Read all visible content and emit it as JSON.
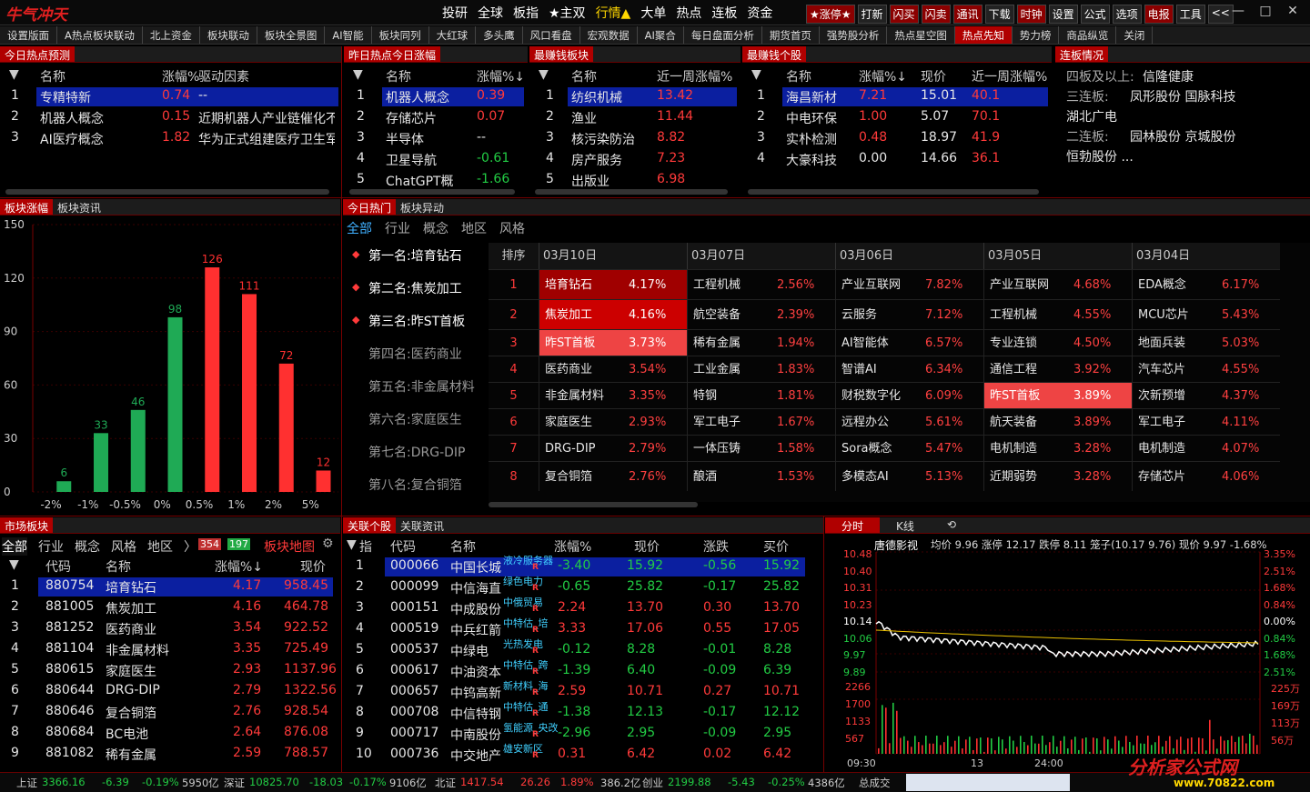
{
  "app": {
    "logo": "牛气冲天"
  },
  "menu": [
    "投研",
    "全球",
    "板指",
    "★主双",
    "行情▲",
    "大单",
    "热点",
    "连板",
    "资金"
  ],
  "right_buttons": [
    "★涨停★",
    "打新",
    "闪买",
    "闪卖",
    "通讯",
    "下载",
    "时钟",
    "设置",
    "公式",
    "选项",
    "电报",
    "工具",
    "<<"
  ],
  "window_controls": [
    "—",
    "□",
    "✕"
  ],
  "tabs": [
    "设置版面",
    "A热点板块联动",
    "北上资金",
    "板块联动",
    "板块全景图",
    "AI智能",
    "板块同列",
    "大红球",
    "多头鹰",
    "风口看盘",
    "宏观数据",
    "AI聚合",
    "每日盘面分析",
    "期货首页",
    "强势股分析",
    "热点星空图",
    "热点先知",
    "势力榜",
    "商品纵览",
    "关闭"
  ],
  "p1": {
    "title": "今日热点预测",
    "headers": [
      "名称",
      "涨幅%",
      "驱动因素"
    ],
    "rows": [
      {
        "n": "1",
        "name": "专精特新",
        "pct": "0.74",
        "drv": "--"
      },
      {
        "n": "2",
        "name": "机器人概念",
        "pct": "0.15",
        "drv": "近期机器人产业链催化不"
      },
      {
        "n": "3",
        "name": "AI医疗概念",
        "pct": "1.82",
        "drv": "华为正式组建医疗卫生军"
      }
    ]
  },
  "p2": {
    "title": "昨日热点今日涨幅",
    "headers": [
      "名称",
      "涨幅%↓"
    ],
    "rows": [
      {
        "n": "1",
        "name": "机器人概念",
        "pct": "0.39"
      },
      {
        "n": "2",
        "name": "存储芯片",
        "pct": "0.07"
      },
      {
        "n": "3",
        "name": "半导体",
        "pct": "--"
      },
      {
        "n": "4",
        "name": "卫星导航",
        "pct": "-0.61"
      },
      {
        "n": "5",
        "name": "ChatGPT概",
        "pct": "-1.66"
      }
    ]
  },
  "p3": {
    "title": "最赚钱板块",
    "headers": [
      "名称",
      "近一周涨幅%"
    ],
    "rows": [
      {
        "n": "1",
        "name": "纺织机械",
        "pct": "13.42"
      },
      {
        "n": "2",
        "name": "渔业",
        "pct": "11.44"
      },
      {
        "n": "3",
        "name": "核污染防治",
        "pct": "8.82"
      },
      {
        "n": "4",
        "name": "房产服务",
        "pct": "7.23"
      },
      {
        "n": "5",
        "name": "出版业",
        "pct": "6.98"
      }
    ]
  },
  "p4": {
    "title": "最赚钱个股",
    "headers": [
      "名称",
      "涨幅%↓",
      "现价",
      "近一周涨幅%"
    ],
    "rows": [
      {
        "n": "1",
        "name": "海昌新材",
        "pct": "7.21",
        "price": "15.01",
        "week": "40.1"
      },
      {
        "n": "2",
        "name": "中电环保",
        "pct": "1.00",
        "price": "5.07",
        "week": "70.1"
      },
      {
        "n": "3",
        "name": "实朴检测",
        "pct": "0.48",
        "price": "18.97",
        "week": "41.9"
      },
      {
        "n": "4",
        "name": "大豪科技",
        "pct": "0.00",
        "price": "14.66",
        "week": "36.1"
      }
    ]
  },
  "p5": {
    "title": "连板情况",
    "lines": [
      {
        "label": "四板及以上:",
        "stocks": "信隆健康"
      },
      {
        "label": "三连板:",
        "stocks": "凤形股份  国脉科技"
      },
      {
        "label": "",
        "stocks": "湖北广电"
      },
      {
        "label": "二连板:",
        "stocks": "园林股份  京城股份"
      },
      {
        "label": "",
        "stocks": "恒勃股份     ..."
      }
    ]
  },
  "chart_panel": {
    "tabs": [
      "板块涨幅",
      "板块资讯"
    ]
  },
  "chart_data": {
    "type": "bar",
    "categories": [
      "-2%",
      "-1%",
      "-0.5%",
      "0%",
      "0.5%",
      "1%",
      "2%",
      "5%"
    ],
    "values": [
      6,
      33,
      46,
      98,
      126,
      111,
      72,
      12
    ],
    "colors": [
      "#1faa55",
      "#1faa55",
      "#1faa55",
      "#1faa55",
      "#ff3030",
      "#ff3030",
      "#ff3030",
      "#ff3030"
    ],
    "ylim": [
      0,
      150
    ],
    "yticks": [
      0,
      30,
      60,
      90,
      120,
      150
    ],
    "grid": true
  },
  "hot": {
    "tabs": [
      "今日热门",
      "板块异动"
    ],
    "filters": [
      "全部",
      "行业",
      "概念",
      "地区",
      "风格"
    ],
    "ranks": [
      "第一名:培育钻石",
      "第二名:焦炭加工",
      "第三名:昨ST首板",
      "第四名:医药商业",
      "第五名:非金属材料",
      "第六名:家庭医生",
      "第七名:DRG-DIP",
      "第八名:复合铜箔"
    ],
    "rank_header": "排序",
    "dates": [
      "03月10日",
      "03月07日",
      "03月06日",
      "03月05日",
      "03月04日"
    ],
    "grid": [
      [
        [
          "培育钻石",
          "4.17%"
        ],
        [
          "工程机械",
          "2.56%"
        ],
        [
          "产业互联网",
          "7.82%"
        ],
        [
          "产业互联网",
          "4.68%"
        ],
        [
          "EDA概念",
          "6.17%"
        ]
      ],
      [
        [
          "焦炭加工",
          "4.16%"
        ],
        [
          "航空装备",
          "2.39%"
        ],
        [
          "云服务",
          "7.12%"
        ],
        [
          "工程机械",
          "4.55%"
        ],
        [
          "MCU芯片",
          "5.43%"
        ]
      ],
      [
        [
          "昨ST首板",
          "3.73%"
        ],
        [
          "稀有金属",
          "1.94%"
        ],
        [
          "AI智能体",
          "6.57%"
        ],
        [
          "专业连锁",
          "4.50%"
        ],
        [
          "地面兵装",
          "5.03%"
        ]
      ],
      [
        [
          "医药商业",
          "3.54%"
        ],
        [
          "工业金属",
          "1.83%"
        ],
        [
          "智谱AI",
          "6.34%"
        ],
        [
          "通信工程",
          "3.92%"
        ],
        [
          "汽车芯片",
          "4.55%"
        ]
      ],
      [
        [
          "非金属材料",
          "3.35%"
        ],
        [
          "特钢",
          "1.81%"
        ],
        [
          "财税数字化",
          "6.09%"
        ],
        [
          "昨ST首板",
          "3.89%"
        ],
        [
          "次新预增",
          "4.37%"
        ]
      ],
      [
        [
          "家庭医生",
          "2.93%"
        ],
        [
          "军工电子",
          "1.67%"
        ],
        [
          "远程办公",
          "5.61%"
        ],
        [
          "航天装备",
          "3.89%"
        ],
        [
          "军工电子",
          "4.11%"
        ]
      ],
      [
        [
          "DRG-DIP",
          "2.79%"
        ],
        [
          "一体压铸",
          "1.58%"
        ],
        [
          "Sora概念",
          "5.47%"
        ],
        [
          "电机制造",
          "3.28%"
        ],
        [
          "电机制造",
          "4.07%"
        ]
      ],
      [
        [
          "复合铜箔",
          "2.76%"
        ],
        [
          "酿酒",
          "1.53%"
        ],
        [
          "多模态AI",
          "5.13%"
        ],
        [
          "近期弱势",
          "3.28%"
        ],
        [
          "存储芯片",
          "4.06%"
        ]
      ]
    ]
  },
  "market": {
    "tabs": [
      "市场板块"
    ],
    "filters": [
      "全部",
      "行业",
      "概念",
      "风格",
      "地区",
      "〉"
    ],
    "up_count": "354",
    "down_count": "197",
    "map_link": "板块地图",
    "headers": [
      "代码",
      "名称",
      "涨幅%↓",
      "现价"
    ],
    "rows": [
      {
        "n": "1",
        "code": "880754",
        "name": "培育钻石",
        "pct": "4.17",
        "price": "958.45"
      },
      {
        "n": "2",
        "code": "881005",
        "name": "焦炭加工",
        "pct": "4.16",
        "price": "464.78"
      },
      {
        "n": "3",
        "code": "881252",
        "name": "医药商业",
        "pct": "3.54",
        "price": "922.52"
      },
      {
        "n": "4",
        "code": "881104",
        "name": "非金属材料",
        "pct": "3.35",
        "price": "725.49"
      },
      {
        "n": "5",
        "code": "880615",
        "name": "家庭医生",
        "pct": "2.93",
        "price": "1137.96"
      },
      {
        "n": "6",
        "code": "880644",
        "name": "DRG-DIP",
        "pct": "2.79",
        "price": "1322.56"
      },
      {
        "n": "7",
        "code": "880646",
        "name": "复合铜箔",
        "pct": "2.76",
        "price": "928.54"
      },
      {
        "n": "8",
        "code": "880684",
        "name": "BC电池",
        "pct": "2.64",
        "price": "876.08"
      },
      {
        "n": "9",
        "code": "881082",
        "name": "稀有金属",
        "pct": "2.59",
        "price": "788.57"
      }
    ]
  },
  "stocks": {
    "tabs": [
      "关联个股",
      "关联资讯"
    ],
    "headers": [
      "指",
      "代码",
      "名称",
      "涨幅%",
      "现价",
      "涨跌",
      "买价"
    ],
    "rows": [
      {
        "n": "1",
        "code": "000066",
        "name": "中国长城",
        "tag": "液冷服务器",
        "pct": "-3.40",
        "price": "15.92",
        "chg": "-0.56",
        "bid": "15.92"
      },
      {
        "n": "2",
        "code": "000099",
        "name": "中信海直",
        "tag": "绿色电力",
        "pct": "-0.65",
        "price": "25.82",
        "chg": "-0.17",
        "bid": "25.82"
      },
      {
        "n": "3",
        "code": "000151",
        "name": "中成股份",
        "tag": "中俄贸易",
        "pct": "2.24",
        "price": "13.70",
        "chg": "0.30",
        "bid": "13.70"
      },
      {
        "n": "4",
        "code": "000519",
        "name": "中兵红箭",
        "tag": "中特估_培",
        "pct": "3.33",
        "price": "17.06",
        "chg": "0.55",
        "bid": "17.05"
      },
      {
        "n": "5",
        "code": "000537",
        "name": "中绿电",
        "tag": "光热发电",
        "pct": "-0.12",
        "price": "8.28",
        "chg": "-0.01",
        "bid": "8.28"
      },
      {
        "n": "6",
        "code": "000617",
        "name": "中油资本",
        "tag": "中特估_跨",
        "pct": "-1.39",
        "price": "6.40",
        "chg": "-0.09",
        "bid": "6.39"
      },
      {
        "n": "7",
        "code": "000657",
        "name": "中钨高新",
        "tag": "新材料_海",
        "pct": "2.59",
        "price": "10.71",
        "chg": "0.27",
        "bid": "10.71"
      },
      {
        "n": "8",
        "code": "000708",
        "name": "中信特钢",
        "tag": "中特估_通",
        "pct": "-1.38",
        "price": "12.13",
        "chg": "-0.17",
        "bid": "12.12"
      },
      {
        "n": "9",
        "code": "000717",
        "name": "中南股份",
        "tag": "氢能源_央改",
        "pct": "-2.96",
        "price": "2.95",
        "chg": "-0.09",
        "bid": "2.95"
      },
      {
        "n": "10",
        "code": "000736",
        "name": "中交地产",
        "tag": "雄安新区",
        "pct": "0.31",
        "price": "6.42",
        "chg": "0.02",
        "bid": "6.42"
      }
    ]
  },
  "intraday": {
    "tabs": [
      "分时",
      "K线",
      "⟲"
    ],
    "name": "唐德影视",
    "info": "均价 9.96 涨停 12.17 跌停 8.11 笼子(10.17 9.76) 现价 9.97 -1.68%",
    "yleft": [
      "10.48",
      "10.40",
      "10.31",
      "10.23",
      "10.14",
      "10.06",
      "9.97",
      "9.89"
    ],
    "yright": [
      "3.35%",
      "2.51%",
      "1.68%",
      "0.84%",
      "0.00%",
      "0.84%",
      "1.68%",
      "2.51%"
    ],
    "vleft": [
      "2266",
      "1700",
      "1133",
      "567"
    ],
    "vright": [
      "225万",
      "169万",
      "113万",
      "56万"
    ],
    "times": [
      "09:30",
      "13",
      "24:00"
    ]
  },
  "footer": {
    "items": [
      {
        "label": "上证",
        "val": "3366.16",
        "chg": "-6.39",
        "pct": "-0.19%",
        "amt": "5950亿"
      },
      {
        "label": "深证",
        "val": "10825.70",
        "chg": "-18.03",
        "pct": "-0.17%",
        "amt": "9106亿"
      },
      {
        "label": "北证",
        "val": "1417.54",
        "chg": "26.26",
        "pct": "1.89%",
        "amt": "386.2亿"
      },
      {
        "label": "创业",
        "val": "2199.88",
        "chg": "-5.43",
        "pct": "-0.25%",
        "amt": "4386亿"
      }
    ],
    "total": "总成交",
    "watermark_main": "分析家公式网",
    "watermark_url": "www.70822.com"
  }
}
